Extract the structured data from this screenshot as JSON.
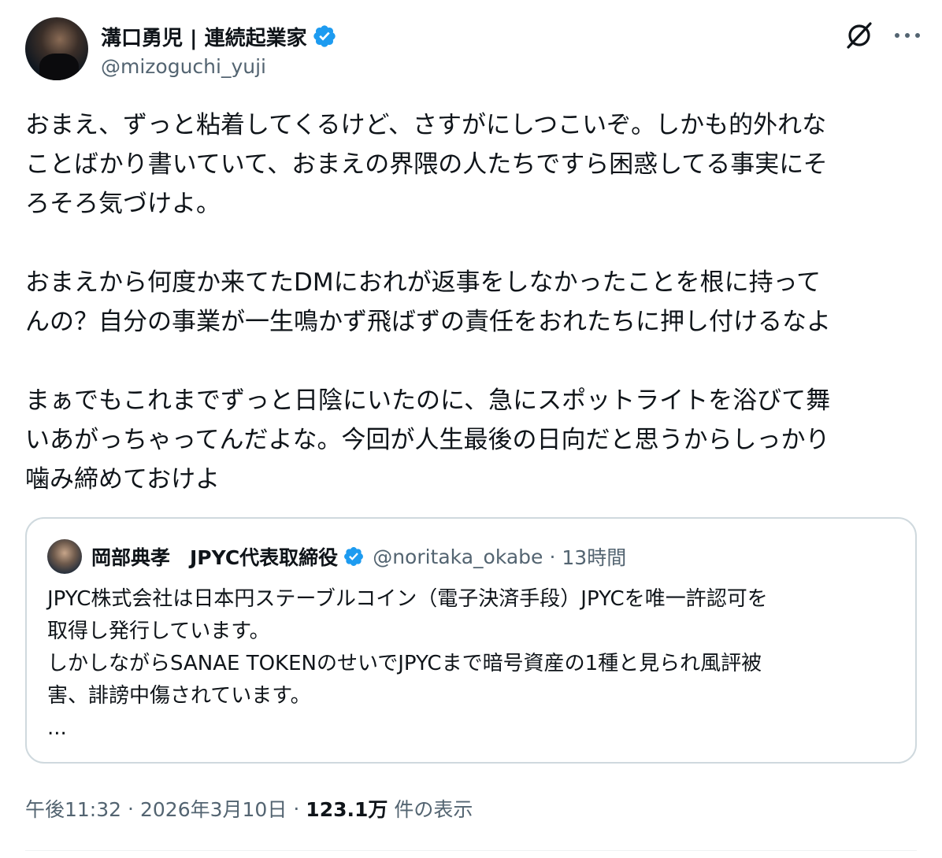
{
  "colors": {
    "accent": "#1d9bf0",
    "text": "#0f1419",
    "secondary": "#536471",
    "border": "#cfd9de"
  },
  "author": {
    "display_name": "溝口勇児 | 連続起業家",
    "handle": "@mizoguchi_yuji",
    "verified_icon": "verified-badge-icon",
    "avatar_icon": "avatar"
  },
  "actions": {
    "grok_icon": "grok-icon",
    "more_icon": "more-options-icon"
  },
  "tweet": {
    "lines": [
      "おまえ、ずっと粘着してくるけど、さすがにしつこいぞ。しかも的外れな",
      "ことばかり書いていて、おまえの界隈の人たちですら困惑してる事実にそ",
      "ろそろ気づけよ。",
      "",
      "おまえから何度か来てたDMにおれが返事をしなかったことを根に持って",
      "んの？自分の事業が一生鳴かず飛ばずの責任をおれたちに押し付けるなよ",
      "",
      "まぁでもこれまでずっと日陰にいたのに、急にスポットライトを浴びて舞",
      "いあがっちゃってんだよな。今回が人生最後の日向だと思うからしっかり",
      "噛み締めておけよ"
    ]
  },
  "quote": {
    "display_name": "岡部典孝　JPYC代表取締役",
    "handle": "@noritaka_okabe",
    "separator": "·",
    "time": "13時間",
    "lines": [
      "JPYC株式会社は日本円ステーブルコイン（電子決済手段）JPYCを唯一許認可を",
      "取得し発行しています。",
      "しかしながらSANAE TOKENのせいでJPYCまで暗号資産の1種と見られ風評被",
      "害、誹謗中傷されています。",
      "..."
    ]
  },
  "meta": {
    "time": "午後11:32",
    "separator": "·",
    "date": "2026年3月10日",
    "views": "123.1万",
    "views_label": "件の表示"
  }
}
